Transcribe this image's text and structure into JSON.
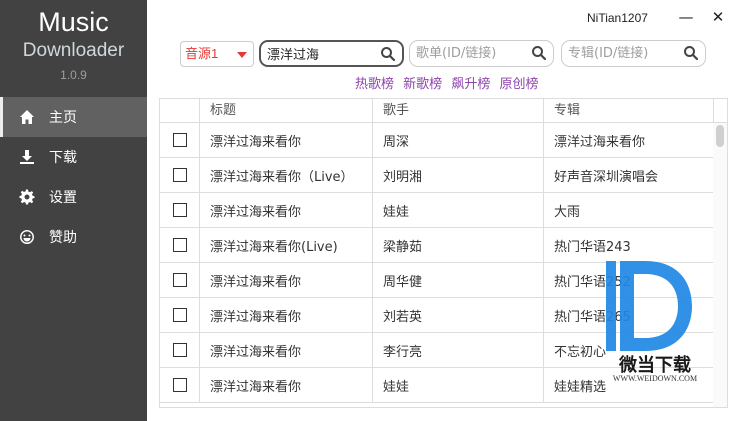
{
  "app": {
    "title": "Music",
    "subtitle": "Downloader",
    "version": "1.0.9"
  },
  "nav": {
    "items": [
      {
        "label": "主页",
        "icon": "home-icon"
      },
      {
        "label": "下载",
        "icon": "download-icon"
      },
      {
        "label": "设置",
        "icon": "gear-icon"
      },
      {
        "label": "赞助",
        "icon": "smile-icon"
      }
    ],
    "active": "主页"
  },
  "window": {
    "user": "NiTian1207",
    "minimize": "—",
    "close": "✕"
  },
  "search": {
    "source": "音源1",
    "song_value": "漂洋过海",
    "playlist_placeholder": "歌单(ID/链接)",
    "album_placeholder": "专辑(ID/链接)"
  },
  "charts": [
    "热歌榜",
    "新歌榜",
    "飙升榜",
    "原创榜"
  ],
  "table": {
    "headers": [
      "标题",
      "歌手",
      "专辑"
    ],
    "rows": [
      {
        "title": "漂洋过海来看你",
        "artist": "周深",
        "album": "漂洋过海来看你"
      },
      {
        "title": "漂洋过海来看你（Live）",
        "artist": "刘明湘",
        "album": "好声音深圳演唱会"
      },
      {
        "title": "漂洋过海来看你",
        "artist": "娃娃",
        "album": "大雨"
      },
      {
        "title": "漂洋过海来看你(Live)",
        "artist": "梁静茹",
        "album": "热门华语243"
      },
      {
        "title": "漂洋过海来看你",
        "artist": "周华健",
        "album": "热门华语252"
      },
      {
        "title": "漂洋过海来看你",
        "artist": "刘若英",
        "album": "热门华语265"
      },
      {
        "title": "漂洋过海来看你",
        "artist": "李行亮",
        "album": "不忘初心"
      },
      {
        "title": "漂洋过海来看你",
        "artist": "娃娃",
        "album": "娃娃精选"
      }
    ]
  },
  "watermark": {
    "text": "微当下载",
    "url": "WWW.WEIDOWN.COM"
  },
  "colors": {
    "sidebar_bg": "#424242",
    "sidebar_active": "#616161",
    "source_red": "#e53935",
    "chart_link": "#8e44ad",
    "watermark_blue": "#1e88e5"
  }
}
